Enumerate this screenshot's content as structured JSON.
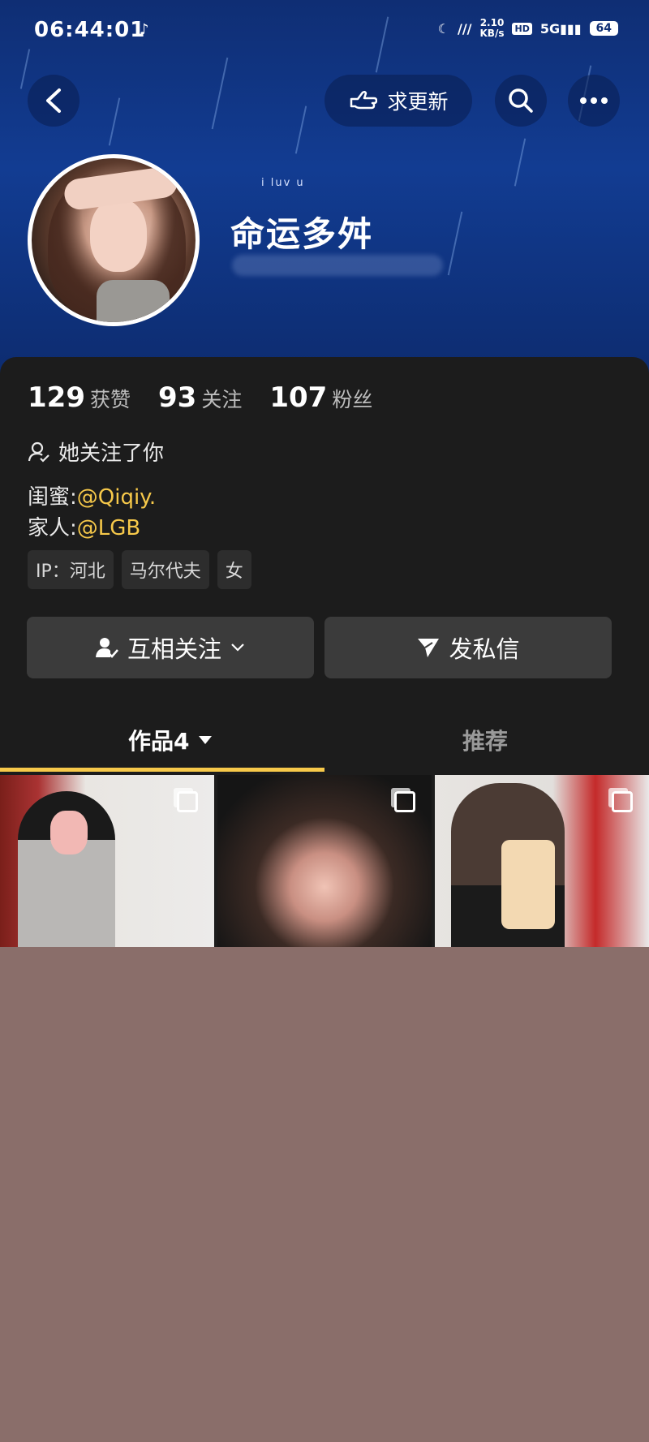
{
  "status_bar": {
    "time": "06:44:01",
    "music_icon": "music-note-icon",
    "network_speed": "2.10\nKB/s",
    "hd_label": "HD",
    "signal_label": "5G",
    "battery": "64"
  },
  "top_bar": {
    "request_update_label": "求更新"
  },
  "profile": {
    "tagline": "i luv u",
    "username": "命运多舛"
  },
  "stats": [
    {
      "value": "129",
      "label": "获赞"
    },
    {
      "value": "93",
      "label": "关注"
    },
    {
      "value": "107",
      "label": "粉丝"
    }
  ],
  "follow_note": "她关注了你",
  "bio": {
    "line1_prefix": "闺蜜:",
    "line1_handle": "@Qiqiy.",
    "line2_prefix": "家人:",
    "line2_handle": "@LGB"
  },
  "tags": [
    "IP：河北",
    "马尔代夫",
    "女"
  ],
  "actions": {
    "mutual_follow_label": "互相关注",
    "message_label": "发私信"
  },
  "tabs": {
    "works_label": "作品",
    "works_count": "4",
    "recommend_label": "推荐"
  },
  "colors": {
    "accent_yellow": "#f7c94a",
    "panel_bg": "#1c1c1c",
    "banner_blue": "#123c92"
  }
}
